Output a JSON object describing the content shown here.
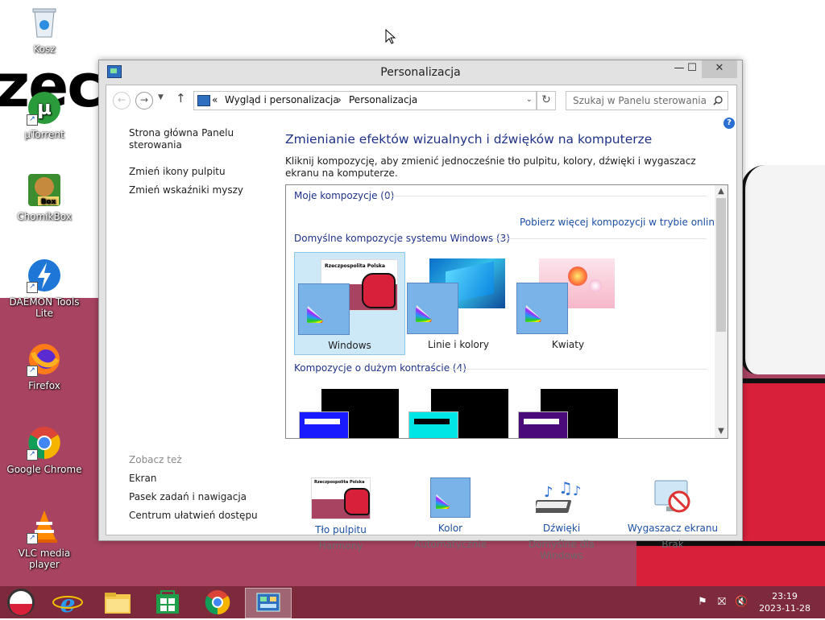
{
  "desktop": {
    "icons": [
      {
        "label": "Kosz"
      },
      {
        "label": "µTorrent"
      },
      {
        "label": "ChomikBox"
      },
      {
        "label": "DAEMON Tools Lite"
      },
      {
        "label": "Firefox"
      },
      {
        "label": "Google Chrome"
      },
      {
        "label": "VLC media player"
      }
    ],
    "wallpaper_text": "zecz"
  },
  "window": {
    "title": "Personalizacja",
    "caption_buttons": {
      "minimize": "—",
      "maximize": "☐",
      "close": "✕"
    },
    "address": {
      "overflow": "«",
      "crumbs": [
        "Wygląd i personalizacja",
        "Personalizacja"
      ],
      "separator": "›"
    },
    "search": {
      "placeholder": "Szukaj w Panelu sterowania"
    },
    "left_links": [
      "Strona główna Panelu sterowania",
      "Zmień ikony pulpitu",
      "Zmień wskaźniki myszy"
    ],
    "see_also": {
      "heading": "Zobacz też",
      "links": [
        "Ekran",
        "Pasek zadań i nawigacja",
        "Centrum ułatwień dostępu"
      ]
    },
    "main": {
      "heading": "Zmienianie efektów wizualnych i dźwięków na komputerze",
      "description": "Kliknij kompozycję, aby zmienić jednocześnie tło pulpitu, kolory, dźwięki i wygaszacz ekranu na komputerze.",
      "groups": {
        "my": "Moje kompozycje (0)",
        "online_link": "Pobierz więcej kompozycji w trybie online",
        "default": "Domyślne kompozycje systemu Windows (3)",
        "high_contrast": "Kompozycje o dużym kontraście (4)"
      },
      "themes": [
        {
          "label": "Windows",
          "selected": true,
          "thumb_text": "Rzeczpospolita Polska"
        },
        {
          "label": "Linie i kolory",
          "selected": false
        },
        {
          "label": "Kwiaty",
          "selected": false
        }
      ],
      "high_contrast_colors": [
        "#1a1aff",
        "#00e6e6",
        "#4b0a7a"
      ]
    },
    "bottom": [
      {
        "link": "Tło pulpitu",
        "sub": "Harmony",
        "thumb_text": "Rzeczpospolita Polska"
      },
      {
        "link": "Kolor",
        "sub": "Automatycznie"
      },
      {
        "link": "Dźwięki",
        "sub": "Domyślne dla Windows"
      },
      {
        "link": "Wygaszacz ekranu",
        "sub": "Brak"
      }
    ]
  },
  "taskbar": {
    "items": [
      "start-orb",
      "internet-explorer",
      "file-explorer",
      "windows-store",
      "google-chrome",
      "control-panel"
    ],
    "clock": {
      "time": "23:19",
      "date": "2023-11-28"
    }
  },
  "colors": {
    "accent_link": "#1b4fa3",
    "heading": "#1e3287",
    "taskbar": "#7c2a3c",
    "wallpaper_red": "#a84461"
  }
}
